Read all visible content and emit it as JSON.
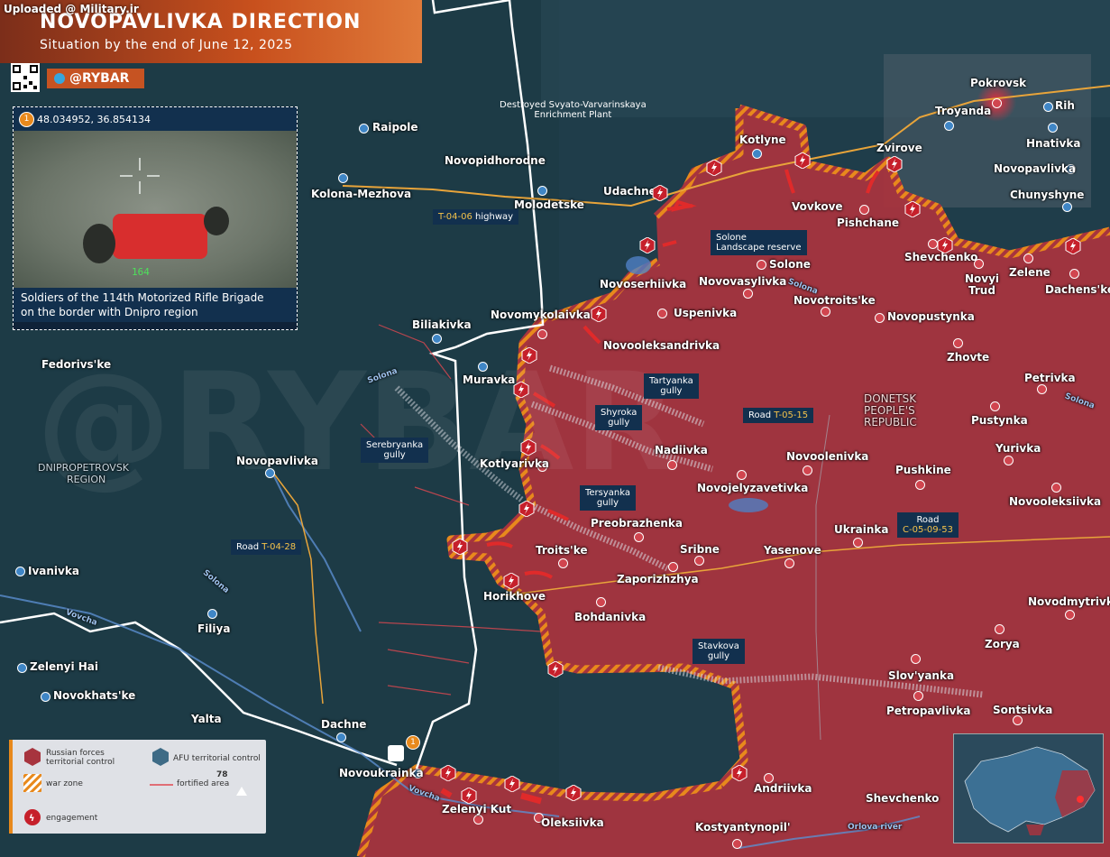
{
  "header": {
    "title": "NOVOPAVLIVKA DIRECTION",
    "subtitle": "Situation by the end of June 12, 2025",
    "source_tag": "Uploaded @ Military.ir",
    "brand": "@RYBAR"
  },
  "photo_panel": {
    "badge": "1",
    "coords": "48.034952, 36.854134",
    "overlay_number": "164",
    "caption_line1": "Soldiers of the 114th Motorized Rifle Brigade",
    "caption_line2": "on the border with Dnipro region"
  },
  "regions": {
    "dnipro_line1": "DNIPROPETROVSK",
    "dnipro_line2": "REGION",
    "donetsk_line1": "DONETSK",
    "donetsk_line2": "PEOPLE'S",
    "donetsk_line3": "REPUBLIC"
  },
  "callouts": {
    "plant_line1": "Destroyed Svyato-Varvarinskaya",
    "plant_line2": "Enrichment Plant",
    "highway_code": "T-04-06",
    "highway_word": "highway",
    "reserve_line1": "Solone",
    "reserve_line2": "Landscape reserve",
    "tartyanka_line1": "Tartyanka",
    "tartyanka_line2": "gully",
    "shyroka_line1": "Shyroka",
    "shyroka_line2": "gully",
    "road_t0515_word": "Road",
    "road_t0515_code": "T-05-15",
    "serebryanka_line1": "Serebryanka",
    "serebryanka_line2": "gully",
    "tersyanka_line1": "Tersyanka",
    "tersyanka_line2": "gully",
    "road_c_word": "Road",
    "road_c_code": "C-05-09-53",
    "road_t0428_word": "Road",
    "road_t0428_code": "T-04-28",
    "stavkova_line1": "Stavkova",
    "stavkova_line2": "gully"
  },
  "rivers": {
    "solona_1": "Solona",
    "solona_2": "Solona",
    "solona_3": "Solona",
    "solona_4": "Solona",
    "vovcha_1": "Vovcha",
    "vovcha_2": "Vovcha",
    "orlova": "Orlova river"
  },
  "places": {
    "pokrovsk": "Pokrovsk",
    "troyanda": "Troyanda",
    "rih": "Rih",
    "hnativka": "Hnativka",
    "novopavlivka_e": "Novopavlivka",
    "chunyshyne": "Chunyshyne",
    "raipole": "Raipole",
    "novopidhorodne": "Novopidhorodne",
    "kolona_mezhova": "Kolona-Mezhova",
    "molodetske": "Molodetske",
    "udachne": "Udachne",
    "kotlyne": "Kotlyne",
    "zvirove": "Zvirove",
    "vovkove": "Vovkove",
    "pishchane": "Pishchane",
    "shevchenko_n": "Shevchenko",
    "zelene": "Zelene",
    "novyi_trud_1": "Novyi",
    "novyi_trud_2": "Trud",
    "dachenske": "Dachens'ke",
    "solone": "Solone",
    "novoserhiivka": "Novoserhiivka",
    "novovasylivka": "Novovasylivka",
    "novotroitske": "Novotroits'ke",
    "uspenivka": "Uspenivka",
    "novopustynka": "Novopustynka",
    "biliakivka": "Biliakivka",
    "novomykolaivka": "Novomykolaivka",
    "novooleksandrivka": "Novooleksandrivka",
    "zhovte": "Zhovte",
    "fedorivske": "Fedorivs'ke",
    "muravka": "Muravka",
    "petrivka": "Petrivka",
    "pustynka": "Pustynka",
    "yurivka": "Yurivka",
    "nadiivka": "Nadiivka",
    "novoolenivka": "Novoolenivka",
    "pushkine": "Pushkine",
    "novopavlivka_w": "Novopavlivka",
    "kotlyarivka": "Kotlyarivka",
    "novojelyzavetivka": "Novojelyzavetivka",
    "novooleksiivka": "Novooleksiivka",
    "preobrazhenka": "Preobrazhenka",
    "ukrainka": "Ukrainka",
    "troitske": "Troits'ke",
    "sribne": "Sribne",
    "yasenove": "Yasenove",
    "ivanivka": "Ivanivka",
    "zaporizhzhya": "Zaporizhzhya",
    "horikhove": "Horikhove",
    "novodmytrivka": "Novodmytrivka",
    "filiya": "Filiya",
    "bohdanivka": "Bohdanivka",
    "zorya": "Zorya",
    "zelenyi_hai": "Zelenyi Hai",
    "slovyanka": "Slov'yanka",
    "novokhatske": "Novokhats'ke",
    "petropavlivka": "Petropavlivka",
    "yalta": "Yalta",
    "sontsivka": "Sontsivka",
    "dachne": "Dachne",
    "novoukrainka": "Novoukrainka",
    "andriivka": "Andriivka",
    "shevchenko_s": "Shevchenko",
    "zelenyi_kut": "Zelenyi Kut",
    "oleksiivka": "Oleksiivka",
    "kostyantynopil": "Kostyantynopil'"
  },
  "legend": {
    "russian_line1": "Russian forces",
    "russian_line2": "territorial control",
    "afu": "AFU territorial control",
    "war_zone": "war zone",
    "fortified": "fortified area",
    "engagement": "engagement",
    "scale_number": "78",
    "badge": "1"
  },
  "colors": {
    "russian_control": "#a7343e",
    "afu_control": "#1e4155",
    "war_zone": "#e8891c",
    "engagement": "#c6202b",
    "callout_bg": "#12304e",
    "highlight": "#f4c24a"
  }
}
